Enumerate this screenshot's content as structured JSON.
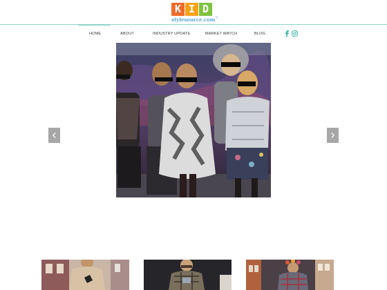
{
  "logo": {
    "letters": [
      "K",
      "I",
      "D"
    ],
    "tagline_main": "stylesource.com",
    "tagline_mark": "™",
    "colors": {
      "k": "#f26b2b",
      "i": "#f7a21b",
      "d": "#7fc241",
      "tagline": "#5aa7d6"
    }
  },
  "nav": {
    "items": [
      {
        "label": "HOME",
        "active": true
      },
      {
        "label": "ABOUT"
      },
      {
        "label": "INDUSTRY UPDATE"
      },
      {
        "label": "MARKET WATCH"
      },
      {
        "label": "BLOG"
      }
    ],
    "social_icons": [
      "facebook-icon",
      "instagram-icon"
    ],
    "accent_color": "#8fd3c8"
  },
  "slider": {
    "prev_glyph": "‹",
    "next_glyph": "›",
    "image": "runway photo of children in faux fur coats and futuristic sunglasses"
  },
  "thumbnails": [
    {
      "image": "child in beige sweater on runway"
    },
    {
      "image": "child in plaid outfit with camera"
    },
    {
      "image": "child with flower crown in check coat"
    }
  ]
}
